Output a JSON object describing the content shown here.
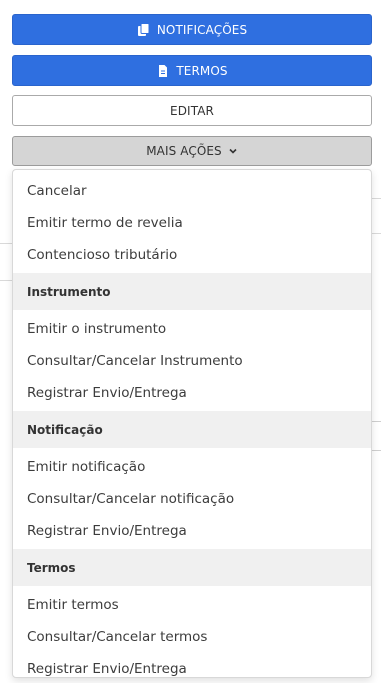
{
  "buttons": {
    "notificacoes": {
      "label": "NOTIFICAÇÕES",
      "icon": "copy-icon"
    },
    "termos": {
      "label": "TERMOS",
      "icon": "document-icon"
    },
    "editar": {
      "label": "EDITAR"
    },
    "mais_acoes": {
      "label": "MAIS AÇÕES",
      "icon": "chevron-down-icon"
    }
  },
  "colors": {
    "primary": "#2f6fe0",
    "header_bg": "#f0f0f0",
    "gray_button": "#d5d5d5"
  },
  "menu": {
    "general": [
      "Cancelar",
      "Emitir termo de revelia",
      "Contencioso tributário"
    ],
    "sections": [
      {
        "header": "Instrumento",
        "items": [
          "Emitir o instrumento",
          "Consultar/Cancelar Instrumento",
          "Registrar Envio/Entrega"
        ]
      },
      {
        "header": "Notificação",
        "items": [
          "Emitir notificação",
          "Consultar/Cancelar notificação",
          "Registrar Envio/Entrega"
        ]
      },
      {
        "header": "Termos",
        "items": [
          "Emitir termos",
          "Consultar/Cancelar termos",
          "Registrar Envio/Entrega"
        ]
      }
    ]
  }
}
